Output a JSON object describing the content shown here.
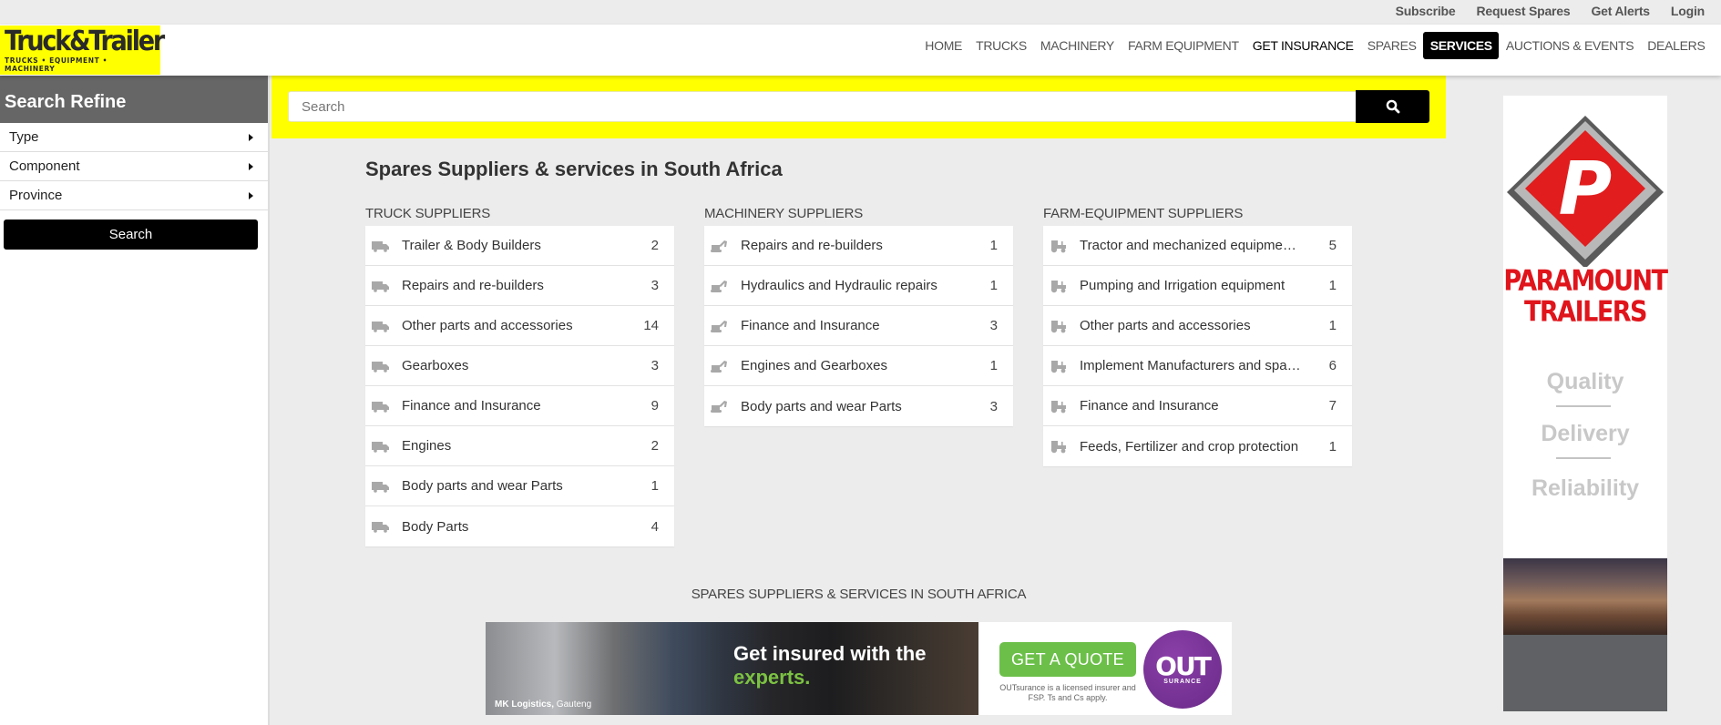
{
  "topbar": {
    "links": [
      "Subscribe",
      "Request Spares",
      "Get Alerts",
      "Login"
    ]
  },
  "logo": {
    "brand": "Truck&Trailer",
    "tagline": "TRUCKS • EQUIPMENT • MACHINERY"
  },
  "nav": {
    "items": [
      {
        "label": "HOME",
        "style": "normal"
      },
      {
        "label": "TRUCKS",
        "style": "normal"
      },
      {
        "label": "MACHINERY",
        "style": "normal"
      },
      {
        "label": "FARM EQUIPMENT",
        "style": "normal"
      },
      {
        "label": "GET INSURANCE",
        "style": "dark"
      },
      {
        "label": "SPARES",
        "style": "normal"
      },
      {
        "label": "SERVICES",
        "style": "active"
      },
      {
        "label": "AUCTIONS & EVENTS",
        "style": "normal"
      },
      {
        "label": "DEALERS",
        "style": "normal"
      }
    ]
  },
  "sidebar": {
    "title": "Search Refine",
    "filters": [
      "Type",
      "Component",
      "Province"
    ],
    "search_label": "Search"
  },
  "search": {
    "placeholder": "Search",
    "value": "",
    "icon": "search-icon"
  },
  "main": {
    "title": "Spares Suppliers & services in South Africa",
    "columns": [
      {
        "heading": "TRUCK SUPPLIERS",
        "icon": "truck-icon",
        "items": [
          {
            "label": "Trailer & Body Builders",
            "count": "2"
          },
          {
            "label": "Repairs and re-builders",
            "count": "3"
          },
          {
            "label": "Other parts and accessories",
            "count": "14"
          },
          {
            "label": "Gearboxes",
            "count": "3"
          },
          {
            "label": "Finance and Insurance",
            "count": "9"
          },
          {
            "label": "Engines",
            "count": "2"
          },
          {
            "label": "Body parts and wear Parts",
            "count": "1"
          },
          {
            "label": "Body Parts",
            "count": "4"
          }
        ]
      },
      {
        "heading": "MACHINERY SUPPLIERS",
        "icon": "excavator-icon",
        "items": [
          {
            "label": "Repairs and re-builders",
            "count": "1"
          },
          {
            "label": "Hydraulics and Hydraulic repairs",
            "count": "1"
          },
          {
            "label": "Finance and Insurance",
            "count": "3"
          },
          {
            "label": "Engines and Gearboxes",
            "count": "1"
          },
          {
            "label": "Body parts and wear Parts",
            "count": "3"
          }
        ]
      },
      {
        "heading": "FARM-EQUIPMENT SUPPLIERS",
        "icon": "tractor-icon",
        "items": [
          {
            "label": "Tractor and mechanized equipment suppliers",
            "count": "5"
          },
          {
            "label": "Pumping and Irrigation equipment",
            "count": "1"
          },
          {
            "label": "Other parts and accessories",
            "count": "1"
          },
          {
            "label": "Implement Manufacturers and spare parts",
            "count": "6"
          },
          {
            "label": "Finance and Insurance",
            "count": "7"
          },
          {
            "label": "Feeds, Fertilizer and crop protection",
            "count": "1"
          }
        ]
      }
    ],
    "footer_title": "SPARES SUPPLIERS & SERVICES IN SOUTH AFRICA"
  },
  "banner": {
    "caption_bold": "MK Logistics,",
    "caption_rest": " Gauteng",
    "headline_line1": "Get insured with the",
    "headline_line2": "experts.",
    "cta": "GET A QUOTE",
    "fine_print": "OUTsurance is a licensed insurer and FSP. Ts and Cs apply.",
    "logo_main": "OUT",
    "logo_sub": "SURANCE",
    "colors": {
      "green": "#6cc04a",
      "purple": "#7a3396"
    }
  },
  "right_ad": {
    "brand_line1": "PARAMOUNT",
    "brand_line2": "TRAILERS",
    "values": [
      "Quality",
      "Delivery",
      "Reliability"
    ],
    "colors": {
      "red": "#e0141b"
    }
  },
  "colors": {
    "accent_yellow": "#ffff00",
    "active_nav": "#000000",
    "sidebar_header": "#666666"
  }
}
